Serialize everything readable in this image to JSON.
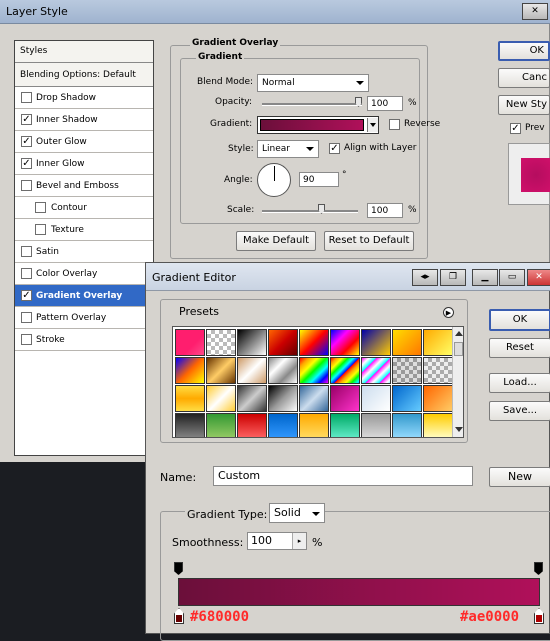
{
  "layer_style": {
    "title": "Layer Style",
    "styles_header": "Styles",
    "blending_label": "Blending Options: Default",
    "items": [
      {
        "label": "Drop Shadow",
        "checked": false
      },
      {
        "label": "Inner Shadow",
        "checked": true
      },
      {
        "label": "Outer Glow",
        "checked": true
      },
      {
        "label": "Inner Glow",
        "checked": true
      },
      {
        "label": "Bevel and Emboss",
        "checked": false
      },
      {
        "label": "Contour",
        "checked": false
      },
      {
        "label": "Texture",
        "checked": false
      },
      {
        "label": "Satin",
        "checked": false
      },
      {
        "label": "Color Overlay",
        "checked": false
      },
      {
        "label": "Gradient Overlay",
        "checked": true,
        "selected": true
      },
      {
        "label": "Pattern Overlay",
        "checked": false
      },
      {
        "label": "Stroke",
        "checked": false
      }
    ],
    "section_title": "Gradient Overlay",
    "subsection_title": "Gradient",
    "blend_mode_label": "Blend Mode:",
    "blend_mode_value": "Normal",
    "opacity_label": "Opacity:",
    "opacity_value": "100",
    "opacity_unit": "%",
    "gradient_label": "Gradient:",
    "reverse_label": "Reverse",
    "style_label": "Style:",
    "style_value": "Linear",
    "align_label": "Align with Layer",
    "angle_label": "Angle:",
    "angle_value": "90",
    "angle_unit": "°",
    "scale_label": "Scale:",
    "scale_value": "100",
    "scale_unit": "%",
    "make_default": "Make Default",
    "reset_default": "Reset to Default",
    "ok": "OK",
    "cancel": "Canc",
    "new_style": "New Sty",
    "preview": "Prev",
    "preview_checked": true
  },
  "gradient_editor": {
    "title": "Gradient Editor",
    "presets_label": "Presets",
    "ok": "OK",
    "reset": "Reset",
    "load": "Load...",
    "save": "Save...",
    "name_label": "Name:",
    "name_value": "Custom",
    "new_button": "New",
    "gradient_type_label": "Gradient Type:",
    "gradient_type_value": "Solid",
    "smoothness_label": "Smoothness:",
    "smoothness_value": "100",
    "smoothness_unit": "%",
    "stop_left_color": "#680000",
    "stop_right_color": "#ae0000"
  },
  "colors": {
    "gradient_start": "#6b0f3a",
    "gradient_end": "#b0105a",
    "selection": "#3169c6",
    "annotation": "#ff2a2a"
  }
}
